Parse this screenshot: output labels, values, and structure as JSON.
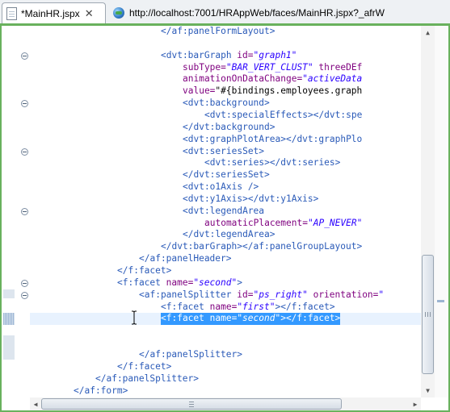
{
  "tabs": [
    {
      "label": "*MainHR.jspx",
      "icon": "jspx-file-icon",
      "active": true,
      "closable": true
    },
    {
      "label": "http://localhost:7001/HRAppWeb/faces/MainHR.jspx?_afrW",
      "icon": "globe-icon",
      "active": false
    }
  ],
  "editor": {
    "lines": [
      {
        "indent": 24,
        "parts": [
          [
            "tag",
            "</af:panelFormLayout>"
          ]
        ]
      },
      {
        "indent": 0,
        "parts": []
      },
      {
        "indent": 24,
        "fold": true,
        "parts": [
          [
            "tag",
            "<dvt:barGraph "
          ],
          [
            "attr",
            "id="
          ],
          [
            "val",
            "\"graph1\""
          ]
        ]
      },
      {
        "indent": 28,
        "parts": [
          [
            "attr",
            "subType="
          ],
          [
            "val",
            "\"BAR_VERT_CLUST\""
          ],
          [
            "plain",
            " "
          ],
          [
            "attr",
            "threeDEf"
          ]
        ]
      },
      {
        "indent": 28,
        "parts": [
          [
            "attr",
            "animationOnDataChange="
          ],
          [
            "val",
            "\"activeData"
          ]
        ]
      },
      {
        "indent": 28,
        "parts": [
          [
            "attr",
            "value="
          ],
          [
            "plain",
            "\"#{bindings.employees.graph"
          ]
        ]
      },
      {
        "indent": 28,
        "fold": true,
        "parts": [
          [
            "tag",
            "<dvt:background>"
          ]
        ]
      },
      {
        "indent": 32,
        "parts": [
          [
            "tag",
            "<dvt:specialEffects></dvt:spe"
          ]
        ]
      },
      {
        "indent": 28,
        "parts": [
          [
            "tag",
            "</dvt:background>"
          ]
        ]
      },
      {
        "indent": 28,
        "parts": [
          [
            "tag",
            "<dvt:graphPlotArea></dvt:graphPlo"
          ]
        ]
      },
      {
        "indent": 28,
        "fold": true,
        "parts": [
          [
            "tag",
            "<dvt:seriesSet>"
          ]
        ]
      },
      {
        "indent": 32,
        "parts": [
          [
            "tag",
            "<dvt:series></dvt:series>"
          ]
        ]
      },
      {
        "indent": 28,
        "parts": [
          [
            "tag",
            "</dvt:seriesSet>"
          ]
        ]
      },
      {
        "indent": 28,
        "parts": [
          [
            "tag",
            "<dvt:o1Axis />"
          ]
        ]
      },
      {
        "indent": 28,
        "parts": [
          [
            "tag",
            "<dvt:y1Axis></dvt:y1Axis>"
          ]
        ]
      },
      {
        "indent": 28,
        "fold": true,
        "parts": [
          [
            "tag",
            "<dvt:legendArea"
          ]
        ]
      },
      {
        "indent": 32,
        "parts": [
          [
            "attr",
            "automaticPlacement="
          ],
          [
            "val",
            "\"AP_NEVER\""
          ]
        ]
      },
      {
        "indent": 28,
        "parts": [
          [
            "tag",
            "</dvt:legendArea>"
          ]
        ]
      },
      {
        "indent": 24,
        "parts": [
          [
            "tag",
            "</dvt:barGraph></af:panelGroupLayout>"
          ]
        ]
      },
      {
        "indent": 20,
        "parts": [
          [
            "tag",
            "</af:panelHeader>"
          ]
        ]
      },
      {
        "indent": 16,
        "parts": [
          [
            "tag",
            "</f:facet>"
          ]
        ]
      },
      {
        "indent": 16,
        "fold": true,
        "parts": [
          [
            "tag",
            "<f:facet "
          ],
          [
            "attr",
            "name="
          ],
          [
            "val",
            "\"second\""
          ],
          [
            "tag",
            ">"
          ]
        ]
      },
      {
        "indent": 20,
        "fold": true,
        "parts": [
          [
            "tag",
            "<af:panelSplitter "
          ],
          [
            "attr",
            "id="
          ],
          [
            "val",
            "\"ps_right\""
          ],
          [
            "plain",
            " "
          ],
          [
            "attr",
            "orientation="
          ],
          [
            "val",
            "\""
          ]
        ]
      },
      {
        "indent": 24,
        "parts": [
          [
            "tag",
            "<f:facet "
          ],
          [
            "attr",
            "name="
          ],
          [
            "val",
            "\"first\""
          ],
          [
            "tag",
            "></f:facet>"
          ]
        ]
      },
      {
        "indent": 24,
        "current": true,
        "selected": true,
        "parts": [
          [
            "tag",
            "<f:facet "
          ],
          [
            "attr",
            "name="
          ],
          [
            "val",
            "\"second\""
          ],
          [
            "tag",
            "></f:facet>"
          ]
        ]
      },
      {
        "indent": 0,
        "parts": []
      },
      {
        "indent": 0,
        "parts": []
      },
      {
        "indent": 20,
        "parts": [
          [
            "tag",
            "</af:panelSplitter>"
          ]
        ]
      },
      {
        "indent": 16,
        "parts": [
          [
            "tag",
            "</f:facet>"
          ]
        ]
      },
      {
        "indent": 12,
        "parts": [
          [
            "tag",
            "</af:panelSplitter>"
          ]
        ]
      },
      {
        "indent": 8,
        "parts": [
          [
            "tag",
            "</af:form>"
          ]
        ]
      }
    ]
  },
  "colors": {
    "frame": "#69b15d",
    "tag": "#2a5ab8",
    "attribute": "#7f007f",
    "value": "#2a00ff",
    "selection": "#3399ff",
    "current_line": "#e8f2fe"
  }
}
